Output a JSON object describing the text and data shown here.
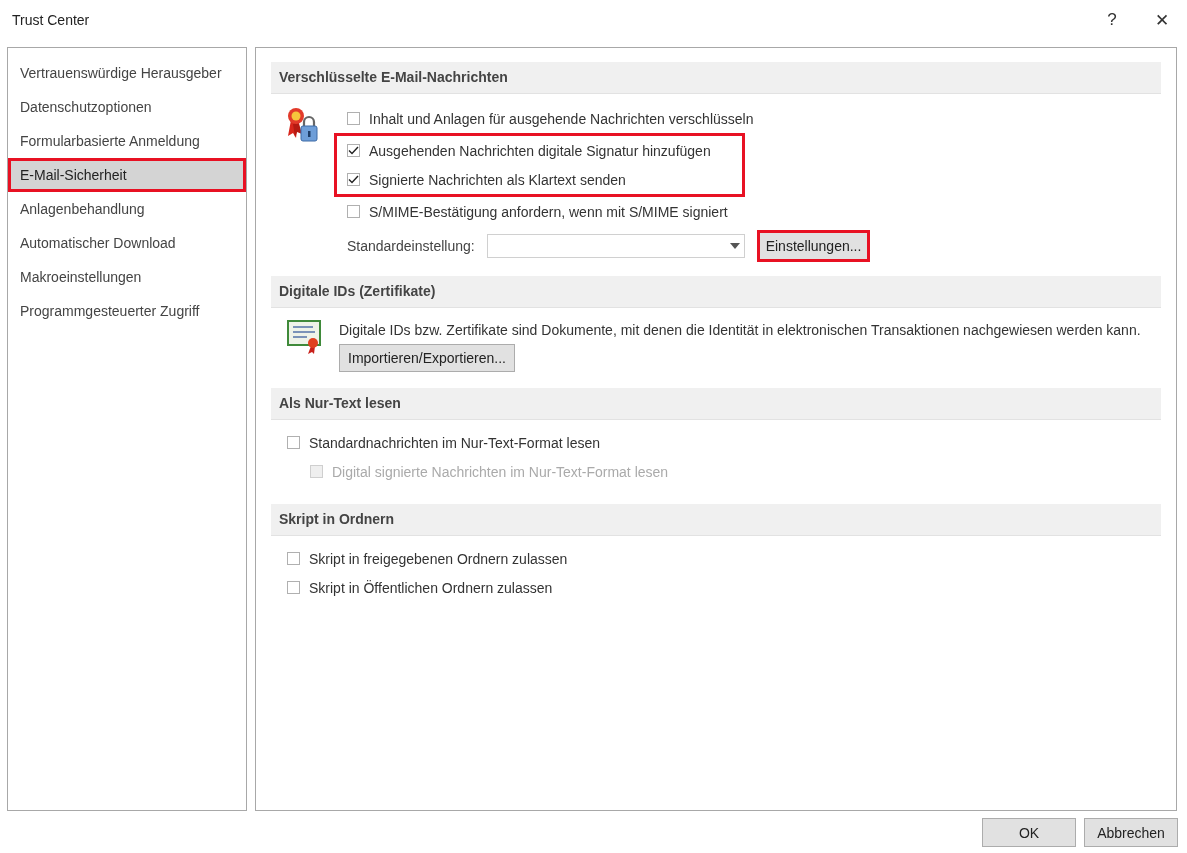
{
  "window": {
    "title": "Trust Center",
    "help": "?",
    "close": "✕"
  },
  "sidebar": {
    "items": [
      {
        "label": "Vertrauenswürdige Herausgeber",
        "selected": false,
        "highlighted": false
      },
      {
        "label": "Datenschutzoptionen",
        "selected": false,
        "highlighted": false
      },
      {
        "label": "Formularbasierte Anmeldung",
        "selected": false,
        "highlighted": false
      },
      {
        "label": "E-Mail-Sicherheit",
        "selected": true,
        "highlighted": true
      },
      {
        "label": "Anlagenbehandlung",
        "selected": false,
        "highlighted": false
      },
      {
        "label": "Automatischer Download",
        "selected": false,
        "highlighted": false
      },
      {
        "label": "Makroeinstellungen",
        "selected": false,
        "highlighted": false
      },
      {
        "label": "Programmgesteuerter Zugriff",
        "selected": false,
        "highlighted": false
      }
    ]
  },
  "sections": [
    {
      "kind": "encryption",
      "title": "Verschlüsselte E-Mail-Nachrichten",
      "groups": [
        {
          "highlighted": false,
          "options": [
            {
              "label": "Inhalt und Anlagen für ausgehende Nachrichten verschlüsseln",
              "checked": false,
              "disabled": false
            }
          ]
        },
        {
          "highlighted": true,
          "options": [
            {
              "label": "Ausgehenden Nachrichten digitale Signatur hinzufügen",
              "checked": true,
              "disabled": false
            },
            {
              "label": "Signierte Nachrichten als Klartext senden",
              "checked": true,
              "disabled": false
            }
          ]
        },
        {
          "highlighted": false,
          "options": [
            {
              "label": "S/MIME-Bestätigung anfordern, wenn mit S/MIME signiert",
              "checked": false,
              "disabled": false
            }
          ]
        }
      ],
      "setting_label": "Standardeinstellung:",
      "button": {
        "label": "Einstellungen...",
        "highlighted": true
      }
    },
    {
      "kind": "ids",
      "title": "Digitale IDs (Zertifikate)",
      "text": "Digitale IDs bzw. Zertifikate sind Dokumente, mit denen die Identität in elektronischen Transaktionen nachgewiesen werden kann.",
      "button": {
        "label": "Importieren/Exportieren...",
        "highlighted": false
      }
    },
    {
      "kind": "options",
      "title": "Als Nur-Text lesen",
      "options": [
        {
          "label": "Standardnachrichten im Nur-Text-Format lesen",
          "checked": false,
          "disabled": false,
          "children": [
            {
              "label": "Digital signierte Nachrichten im Nur-Text-Format lesen",
              "checked": false,
              "disabled": true
            }
          ]
        }
      ]
    },
    {
      "kind": "options",
      "title": "Skript in Ordnern",
      "options": [
        {
          "label": "Skript in freigegebenen Ordnern zulassen",
          "checked": false,
          "disabled": false
        },
        {
          "label": "Skript in Öffentlichen Ordnern zulassen",
          "checked": false,
          "disabled": false
        }
      ]
    }
  ],
  "buttons": [
    "OK",
    "Abbrechen"
  ]
}
